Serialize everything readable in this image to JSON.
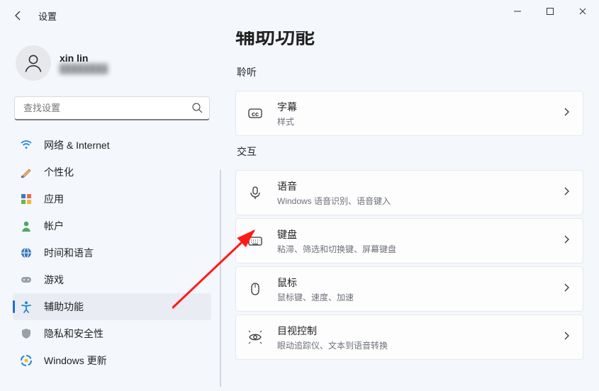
{
  "window": {
    "title": "设置"
  },
  "user": {
    "name": "xin lin",
    "sub": "████████"
  },
  "search": {
    "placeholder": "查找设置"
  },
  "sidebar": {
    "items": [
      {
        "label": "网络 & Internet"
      },
      {
        "label": "个性化"
      },
      {
        "label": "应用"
      },
      {
        "label": "帐户"
      },
      {
        "label": "时间和语言"
      },
      {
        "label": "游戏"
      },
      {
        "label": "辅助功能",
        "active": true
      },
      {
        "label": "隐私和安全性"
      },
      {
        "label": "Windows 更新"
      }
    ]
  },
  "page": {
    "title": "辅助功能"
  },
  "sections": [
    {
      "label": "聆听",
      "items": [
        {
          "title": "字幕",
          "sub": "样式"
        }
      ]
    },
    {
      "label": "交互",
      "items": [
        {
          "title": "语音",
          "sub": "Windows 语音识别、语音键入"
        },
        {
          "title": "键盘",
          "sub": "粘滞、筛选和切换键、屏幕键盘"
        },
        {
          "title": "鼠标",
          "sub": "鼠标键、速度、加速"
        },
        {
          "title": "目视控制",
          "sub": "眼动追踪仪、文本到语音转换"
        }
      ]
    }
  ]
}
